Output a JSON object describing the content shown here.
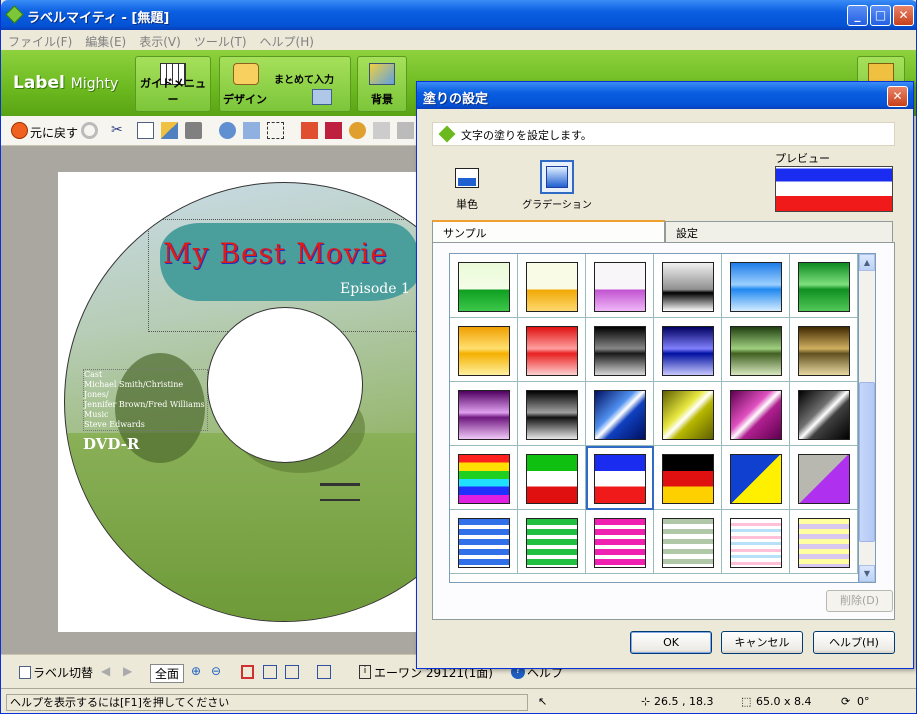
{
  "window": {
    "title": "ラベルマイティ - [無題]",
    "minimize": "_",
    "maximize": "□",
    "close": "✕"
  },
  "menu": [
    "ファイル(F)",
    "編集(E)",
    "表示(V)",
    "ツール(T)",
    "ヘルプ(H)"
  ],
  "ribbon": {
    "logo_main": "Label",
    "logo_sub": "Mighty",
    "buttons": [
      {
        "label": "ガイドメニュー",
        "icon": "grid-icon"
      },
      {
        "label": "デザイン",
        "icon": "design-icon"
      },
      {
        "label": "まとめて入力",
        "icon": "bulk-input-icon"
      },
      {
        "label": "背景",
        "icon": "background-icon"
      }
    ]
  },
  "toolbar": {
    "undo_label": "元に戻す"
  },
  "label": {
    "title": "My Best Movie",
    "episode": "Episode 1",
    "cast": [
      "Cast",
      "Michael Smith/Christine Jones/",
      "Jennifer Brown/Fred Williams",
      "Music",
      "Steve Edwards"
    ],
    "media": "DVD-R"
  },
  "bottombar": {
    "switch_label": "ラベル切替",
    "zoom_label": "全面",
    "paper_label": "エーワン 29121(1面)",
    "help_label": "ヘルプ"
  },
  "status": {
    "hint": "ヘルプを表示するには[F1]を押してください",
    "position": "26.5 , 18.3",
    "size": "65.0 x 8.4",
    "rotation": "0°"
  },
  "dialog": {
    "title": "塗りの設定",
    "info": "文字の塗りを設定します。",
    "mode_solid": "単色",
    "mode_gradient": "グラデーション",
    "preview_label": "プレビュー",
    "tabs": [
      "サンプル",
      "設定"
    ],
    "delete_label": "削除(D)",
    "ok": "OK",
    "cancel": "キャンセル",
    "help": "ヘルプ(H)",
    "swatches": [
      [
        "linear-gradient(#eafbd8 0%,#f4fde8 55%,#0e9e20 55%,#3dc84a 100%)",
        "linear-gradient(#fafbe6 0%,#fafbe6 55%,#f0a800 55%,#ffd870 100%)",
        "linear-gradient(#f8f6f8 0%,#f8f6f8 55%,#c050d0 55%,#f0b8f8 100%)",
        "linear-gradient(#f0f0f0,#909090 55%,#000 62%,#fff)",
        "linear-gradient(#1e7ce8,#9cd0ff 45%,#2088f0 55%,#d4ecff)",
        "linear-gradient(#0e8a20,#7ee07e 45%,#109020 55%,#52c85a)"
      ],
      [
        "linear-gradient(#f0a000,#ffe070 45%,#f4b000 55%,#fff0a0)",
        "linear-gradient(#e01010,#ffa0a0 45%,#e82020 55%,#ffd0d0)",
        "linear-gradient(#000,#888 45%,#181818 55%,#d8d8d8)",
        "linear-gradient(#000060,#8080ff 45%,#0010a0 55%,#c8c8ff)",
        "linear-gradient(#204010,#a0d080 45%,#406020 55%,#d8e8c0)",
        "linear-gradient(#402800,#d0b060 45%,#605020 55%,#e8d8a0)"
      ],
      [
        "linear-gradient(#500060,#e0a0f0 45%,#701880 55%,#f0c8f8)",
        "linear-gradient(#000,#a0a0a0 45%,#101010 55%,#e8e8e8)",
        "linear-gradient(135deg,#001060,#5090f0 40%,#fff 50%,#1040c0 60%,#001060)",
        "linear-gradient(135deg,#606000,#e8e840 40%,#fff 50%,#b8b800 60%,#606000)",
        "linear-gradient(135deg,#600050,#e050c0 40%,#fff 50%,#b02090 60%,#600050)",
        "linear-gradient(135deg,#000,#707070 40%,#fff 50%,#404040 60%,#000)"
      ],
      [
        "linear-gradient(#ff2020 0%,#ff2020 16%,#ffe000 16%,#ffe000 33%,#20d020 33%,#20d020 50%,#20e0ff 50%,#20e0ff 66%,#2030ff 66%,#2030ff 83%,#e020e0 83%,#e020e0 100%)",
        "linear-gradient(#10c010 0%,#10c010 33%,#fff 33%,#fff 66%,#e01010 66%,#e01010 100%)",
        "linear-gradient(#1a2cf0 0%,#1a2cf0 33%,#fff 33%,#fff 66%,#f01a1a 66%,#f01a1a 100%)",
        "linear-gradient(#000 0%,#000 33%,#e01010 33%,#e01010 66%,#ffd000 66%,#ffd000 100%)",
        "linear-gradient(135deg,#1040d0 50%,#fff000 50%)",
        "linear-gradient(135deg,#b8b8b0 50%,#b030f0 50%)"
      ],
      [
        "repeating-linear-gradient(#3070e8 0 6px,#fff 6px 10px)",
        "repeating-linear-gradient(#20c040 0 6px,#fff 6px 10px)",
        "repeating-linear-gradient(#f020b0 0 6px,#fff 6px 10px)",
        "repeating-linear-gradient(#b0c8a8 0 5px,#fff 5px 10px)",
        "repeating-linear-gradient(#fff 0 4px,#ffc0d8 4px 7px,#fff 7px 10px,#b8e0f8 10px 13px)",
        "repeating-linear-gradient(#ffffa0 0 5px,#d8c8f0 5px 10px)"
      ]
    ],
    "selected_row": 3,
    "selected_col": 2
  }
}
